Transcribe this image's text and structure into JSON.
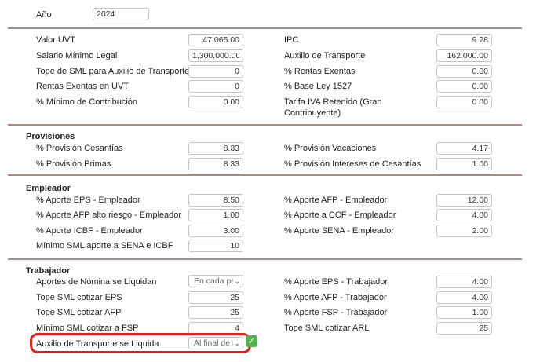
{
  "year": {
    "label": "Año",
    "value": "2024"
  },
  "general": {
    "left": [
      {
        "label": "Valor UVT",
        "value": "47,065.00"
      },
      {
        "label": "Salario Mínimo Legal",
        "value": "1,300,000.00"
      },
      {
        "label": "Tope de SML para Auxilio de Transporte",
        "value": "0"
      },
      {
        "label": "Rentas Exentas en UVT",
        "value": "0"
      },
      {
        "label": "% Mínimo de Contribución",
        "value": "0.00"
      }
    ],
    "right": [
      {
        "label": "IPC",
        "value": "9.28"
      },
      {
        "label": "Auxilio de Transporte",
        "value": "162,000.00"
      },
      {
        "label": "% Rentas Exentas",
        "value": "0.00"
      },
      {
        "label": "% Base Ley 1527",
        "value": "0.00"
      },
      {
        "label": "Tarifa IVA Retenido (Gran",
        "label2": "Contribuyente)",
        "value": "0.00"
      }
    ]
  },
  "provisiones": {
    "title": "Provisiones",
    "left": [
      {
        "label": "% Provisión Cesantías",
        "value": "8.33"
      },
      {
        "label": "% Provisión Primas",
        "value": "8.33"
      }
    ],
    "right": [
      {
        "label": "% Provisión Vacaciones",
        "value": "4.17"
      },
      {
        "label": "% Provisión Intereses de Cesantías",
        "value": "1.00"
      }
    ]
  },
  "empleador": {
    "title": "Empleador",
    "left": [
      {
        "label": "% Aporte EPS - Empleador",
        "value": "8.50"
      },
      {
        "label": "% Aporte AFP alto riesgo - Empleador",
        "value": "1.00"
      },
      {
        "label": "% Aporte ICBF - Empleador",
        "value": "3.00"
      },
      {
        "label": "Mínimo SML aporte a SENA e ICBF",
        "value": "10"
      }
    ],
    "right": [
      {
        "label": "% Aporte AFP - Empleador",
        "value": "12.00"
      },
      {
        "label": "% Aporte a CCF - Empleador",
        "value": "4.00"
      },
      {
        "label": "% Aporte SENA - Empleador",
        "value": "2.00"
      }
    ]
  },
  "trabajador": {
    "title": "Trabajador",
    "left": [
      {
        "label": "Aportes de Nómina se Liquidan",
        "select": "En cada período"
      },
      {
        "label": "Tope SML cotizar EPS",
        "value": "25"
      },
      {
        "label": "Tope SML cotizar AFP",
        "value": "25"
      },
      {
        "label": "Mínimo SML cotizar a FSP",
        "value": "4"
      },
      {
        "label": "Auxilio de Transporte se Liquida",
        "select": "Al final de mes"
      }
    ],
    "right": [
      {
        "label": "% Aporte EPS - Trabajador",
        "value": "4.00"
      },
      {
        "label": "% Aporte AFP - Trabajador",
        "value": "4.00"
      },
      {
        "label": "% Aporte FSP - Trabajador",
        "value": "1.00"
      },
      {
        "label": "Tope SML cotizar ARL",
        "value": "25"
      }
    ]
  },
  "colors": {
    "highlight": "#e3201b",
    "check": "#4cb648",
    "divider": "#a88a8a"
  },
  "icons": {
    "check": "check-mark-icon",
    "chevron": "chevron-down-icon"
  }
}
